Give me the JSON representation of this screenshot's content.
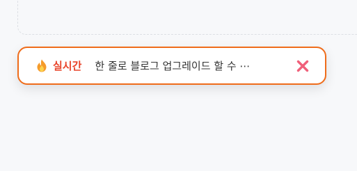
{
  "toast": {
    "icon": "fire-icon",
    "label": "실시간",
    "message": "한 줄로 블로그 업그레이드 할 수 ⋯",
    "close_icon": "close-icon",
    "colors": {
      "border": "#ef6c1a",
      "label": "#e8452b",
      "close": "#f0607a"
    }
  }
}
